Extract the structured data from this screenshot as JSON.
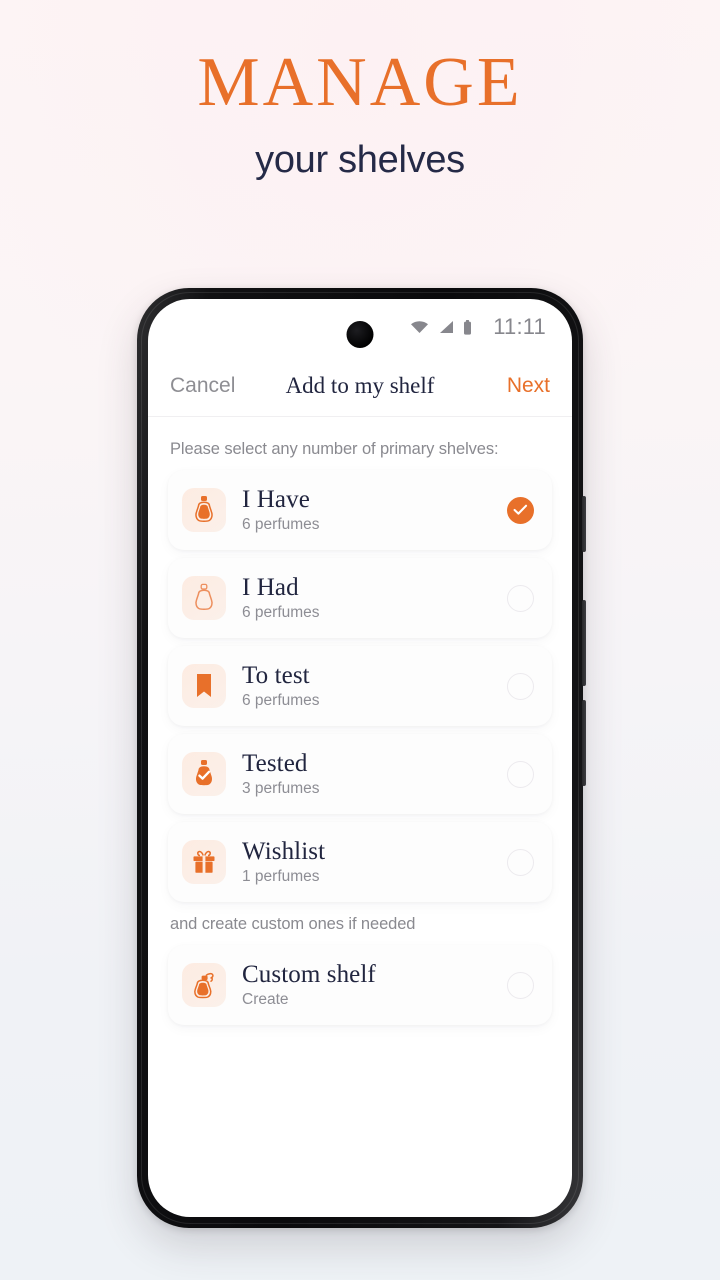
{
  "promo": {
    "title": "MANAGE",
    "subtitle": "your shelves",
    "title_color": "#e8702a",
    "subtitle_color": "#252a47"
  },
  "phone": {
    "statusbar": {
      "time": "11:11",
      "icons": [
        "wifi-icon",
        "cellular-signal-icon",
        "battery-icon"
      ]
    },
    "navbar": {
      "cancel_label": "Cancel",
      "title": "Add to my shelf",
      "next_label": "Next",
      "next_color": "#e8702a"
    },
    "screen": {
      "primary_section_label": "Please select any number of primary shelves:",
      "custom_section_label": "and create custom ones if needed",
      "accent_color": "#e8702a",
      "primary_shelves": [
        {
          "title": "I Have",
          "subtitle": "6 perfumes",
          "icon": "perfume-bottle-filled-icon",
          "selected": true
        },
        {
          "title": "I Had",
          "subtitle": "6 perfumes",
          "icon": "perfume-bottle-outline-icon",
          "selected": false
        },
        {
          "title": "To test",
          "subtitle": "6 perfumes",
          "icon": "bookmark-icon",
          "selected": false
        },
        {
          "title": "Tested",
          "subtitle": "3 perfumes",
          "icon": "perfume-bottle-check-icon",
          "selected": false
        },
        {
          "title": "Wishlist",
          "subtitle": "1 perfumes",
          "icon": "gift-icon",
          "selected": false
        }
      ],
      "custom_shelves": [
        {
          "title": "Custom shelf",
          "subtitle": "Create",
          "icon": "perfume-atomizer-icon",
          "selected": false
        }
      ]
    }
  }
}
